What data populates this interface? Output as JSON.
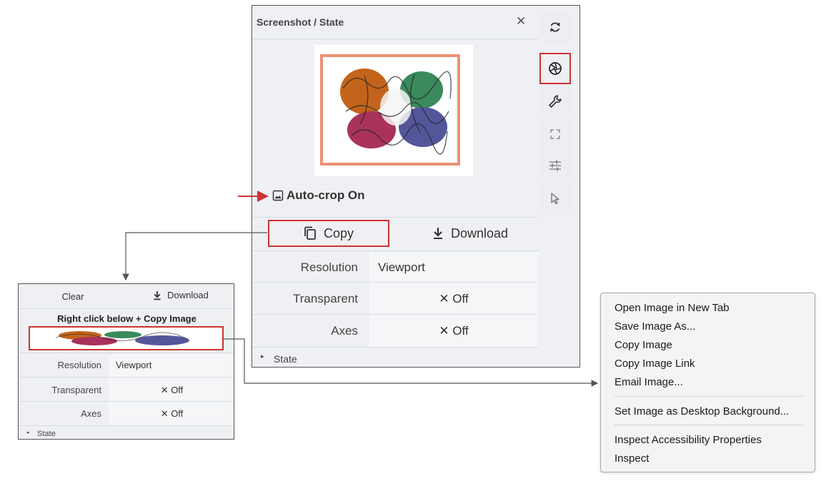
{
  "main_panel": {
    "title": "Screenshot / State",
    "close_glyph": "✕",
    "autocrop_label": "Auto-crop On",
    "copy_label": "Copy",
    "download_label": "Download",
    "rows": [
      {
        "label": "Resolution",
        "value": "Viewport"
      },
      {
        "label": "Transparent",
        "value": "✕ Off"
      },
      {
        "label": "Axes",
        "value": "✕ Off"
      }
    ],
    "state_label": "State",
    "state_caret": "▸"
  },
  "toolbar": {
    "items": [
      "refresh-icon",
      "camera-aperture-icon",
      "wrench-icon",
      "expand-icon",
      "sliders-icon",
      "cursor-icon"
    ],
    "highlight_color": "#c33333"
  },
  "small_panel": {
    "clear_label": "Clear",
    "download_label": "Download",
    "instruction": "Right click below + Copy Image",
    "rows": [
      {
        "label": "Resolution",
        "value": "Viewport"
      },
      {
        "label": "Transparent",
        "value": "✕ Off"
      },
      {
        "label": "Axes",
        "value": "✕ Off"
      }
    ],
    "state_label": "State",
    "state_caret": "▸"
  },
  "context_menu": {
    "groups": [
      [
        "Open Image in New Tab",
        "Save Image As...",
        "Copy Image",
        "Copy Image Link",
        "Email Image..."
      ],
      [
        "Set Image as Desktop Background..."
      ],
      [
        "Inspect Accessibility Properties",
        "Inspect"
      ]
    ]
  },
  "colors": {
    "highlight": "#c33333",
    "crop_frame": "#ec9074",
    "panel_bg": "#eef0f3"
  }
}
